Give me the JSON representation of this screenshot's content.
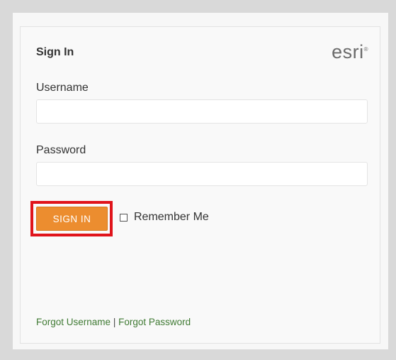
{
  "header": {
    "title": "Sign In",
    "logo_text": "esri",
    "logo_mark": "®"
  },
  "form": {
    "username_label": "Username",
    "username_value": "",
    "password_label": "Password",
    "password_value": "",
    "signin_label": "SIGN IN",
    "remember_label": "Remember Me",
    "remember_checked": false
  },
  "footer": {
    "forgot_username": "Forgot Username",
    "separator": "|",
    "forgot_password": "Forgot Password"
  },
  "colors": {
    "signin_button": "#ec8d2f",
    "highlight_box": "#e0141b",
    "link": "#3f7a33"
  }
}
